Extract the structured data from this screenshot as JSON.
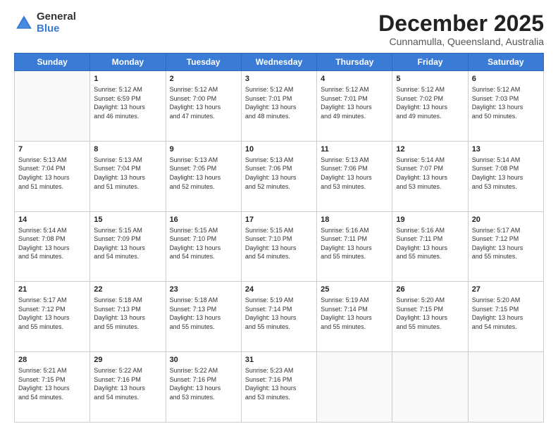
{
  "logo": {
    "general": "General",
    "blue": "Blue"
  },
  "header": {
    "month_title": "December 2025",
    "subtitle": "Cunnamulla, Queensland, Australia"
  },
  "days_of_week": [
    "Sunday",
    "Monday",
    "Tuesday",
    "Wednesday",
    "Thursday",
    "Friday",
    "Saturday"
  ],
  "weeks": [
    [
      {
        "day": "",
        "info": ""
      },
      {
        "day": "1",
        "info": "Sunrise: 5:12 AM\nSunset: 6:59 PM\nDaylight: 13 hours\nand 46 minutes."
      },
      {
        "day": "2",
        "info": "Sunrise: 5:12 AM\nSunset: 7:00 PM\nDaylight: 13 hours\nand 47 minutes."
      },
      {
        "day": "3",
        "info": "Sunrise: 5:12 AM\nSunset: 7:01 PM\nDaylight: 13 hours\nand 48 minutes."
      },
      {
        "day": "4",
        "info": "Sunrise: 5:12 AM\nSunset: 7:01 PM\nDaylight: 13 hours\nand 49 minutes."
      },
      {
        "day": "5",
        "info": "Sunrise: 5:12 AM\nSunset: 7:02 PM\nDaylight: 13 hours\nand 49 minutes."
      },
      {
        "day": "6",
        "info": "Sunrise: 5:12 AM\nSunset: 7:03 PM\nDaylight: 13 hours\nand 50 minutes."
      }
    ],
    [
      {
        "day": "7",
        "info": "Sunrise: 5:13 AM\nSunset: 7:04 PM\nDaylight: 13 hours\nand 51 minutes."
      },
      {
        "day": "8",
        "info": "Sunrise: 5:13 AM\nSunset: 7:04 PM\nDaylight: 13 hours\nand 51 minutes."
      },
      {
        "day": "9",
        "info": "Sunrise: 5:13 AM\nSunset: 7:05 PM\nDaylight: 13 hours\nand 52 minutes."
      },
      {
        "day": "10",
        "info": "Sunrise: 5:13 AM\nSunset: 7:06 PM\nDaylight: 13 hours\nand 52 minutes."
      },
      {
        "day": "11",
        "info": "Sunrise: 5:13 AM\nSunset: 7:06 PM\nDaylight: 13 hours\nand 53 minutes."
      },
      {
        "day": "12",
        "info": "Sunrise: 5:14 AM\nSunset: 7:07 PM\nDaylight: 13 hours\nand 53 minutes."
      },
      {
        "day": "13",
        "info": "Sunrise: 5:14 AM\nSunset: 7:08 PM\nDaylight: 13 hours\nand 53 minutes."
      }
    ],
    [
      {
        "day": "14",
        "info": "Sunrise: 5:14 AM\nSunset: 7:08 PM\nDaylight: 13 hours\nand 54 minutes."
      },
      {
        "day": "15",
        "info": "Sunrise: 5:15 AM\nSunset: 7:09 PM\nDaylight: 13 hours\nand 54 minutes."
      },
      {
        "day": "16",
        "info": "Sunrise: 5:15 AM\nSunset: 7:10 PM\nDaylight: 13 hours\nand 54 minutes."
      },
      {
        "day": "17",
        "info": "Sunrise: 5:15 AM\nSunset: 7:10 PM\nDaylight: 13 hours\nand 54 minutes."
      },
      {
        "day": "18",
        "info": "Sunrise: 5:16 AM\nSunset: 7:11 PM\nDaylight: 13 hours\nand 55 minutes."
      },
      {
        "day": "19",
        "info": "Sunrise: 5:16 AM\nSunset: 7:11 PM\nDaylight: 13 hours\nand 55 minutes."
      },
      {
        "day": "20",
        "info": "Sunrise: 5:17 AM\nSunset: 7:12 PM\nDaylight: 13 hours\nand 55 minutes."
      }
    ],
    [
      {
        "day": "21",
        "info": "Sunrise: 5:17 AM\nSunset: 7:12 PM\nDaylight: 13 hours\nand 55 minutes."
      },
      {
        "day": "22",
        "info": "Sunrise: 5:18 AM\nSunset: 7:13 PM\nDaylight: 13 hours\nand 55 minutes."
      },
      {
        "day": "23",
        "info": "Sunrise: 5:18 AM\nSunset: 7:13 PM\nDaylight: 13 hours\nand 55 minutes."
      },
      {
        "day": "24",
        "info": "Sunrise: 5:19 AM\nSunset: 7:14 PM\nDaylight: 13 hours\nand 55 minutes."
      },
      {
        "day": "25",
        "info": "Sunrise: 5:19 AM\nSunset: 7:14 PM\nDaylight: 13 hours\nand 55 minutes."
      },
      {
        "day": "26",
        "info": "Sunrise: 5:20 AM\nSunset: 7:15 PM\nDaylight: 13 hours\nand 55 minutes."
      },
      {
        "day": "27",
        "info": "Sunrise: 5:20 AM\nSunset: 7:15 PM\nDaylight: 13 hours\nand 54 minutes."
      }
    ],
    [
      {
        "day": "28",
        "info": "Sunrise: 5:21 AM\nSunset: 7:15 PM\nDaylight: 13 hours\nand 54 minutes."
      },
      {
        "day": "29",
        "info": "Sunrise: 5:22 AM\nSunset: 7:16 PM\nDaylight: 13 hours\nand 54 minutes."
      },
      {
        "day": "30",
        "info": "Sunrise: 5:22 AM\nSunset: 7:16 PM\nDaylight: 13 hours\nand 53 minutes."
      },
      {
        "day": "31",
        "info": "Sunrise: 5:23 AM\nSunset: 7:16 PM\nDaylight: 13 hours\nand 53 minutes."
      },
      {
        "day": "",
        "info": ""
      },
      {
        "day": "",
        "info": ""
      },
      {
        "day": "",
        "info": ""
      }
    ]
  ]
}
